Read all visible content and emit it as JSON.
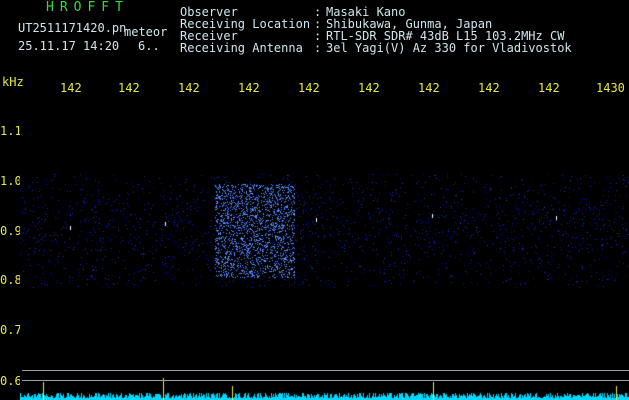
{
  "header": {
    "app_title": "HROFFT",
    "file_name": "UT2511171420.pn",
    "mode_label": "meteor",
    "timestamp": "25.11.17 14:20",
    "counter": "6.."
  },
  "info": {
    "labels": [
      "Observer",
      "Receiving Location",
      "Receiver",
      "Receiving Antenna"
    ],
    "separators": [
      ":",
      ":",
      ":",
      ":"
    ],
    "values": [
      "Masaki Kano",
      "Shibukawa, Gunma, Japan",
      "RTL-SDR SDR# 43dB L15 103.2MHz CW",
      "3el Yagi(V) Az 330 for Vladivostok"
    ]
  },
  "y_axis": {
    "unit": "kHz",
    "ticks": [
      "1.1",
      "1.0",
      "0.9",
      "0.8",
      "0.7",
      "0.6"
    ]
  },
  "time_axis": {
    "ticks": [
      "142",
      "142",
      "142",
      "142",
      "142",
      "142",
      "142",
      "142",
      "142",
      "1430"
    ]
  },
  "colors": {
    "background": "#000000",
    "text": "#cfe6ee",
    "title": "#33dd33",
    "axis_labels": "#e8e840",
    "signal": "#2a4cff",
    "power_trace": "#00e5ff"
  }
}
